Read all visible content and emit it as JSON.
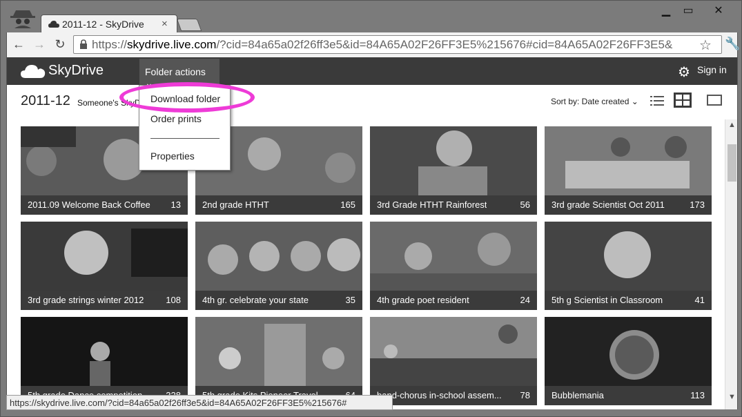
{
  "browser": {
    "tab_title": "2011-12 - SkyDrive",
    "tab_close": "×",
    "url_scheme": "https://",
    "url_host": "skydrive.live.com",
    "url_rest": "/?cid=84a65a02f26ff3e5&id=84A65A02F26FF3E5%215676#cid=84A65A02F26FF3E5&",
    "status_url": "https://skydrive.live.com/?cid=84a65a02f26ff3e5&id=84A65A02F26FF3E5%215676#"
  },
  "header": {
    "brand": "SkyDrive",
    "folder_actions": "Folder actions",
    "sign_in": "Sign in"
  },
  "page": {
    "title": "2011-12",
    "owner_crumb": "Someone's SkyD",
    "sort_label": "Sort by: Date created"
  },
  "dropdown": {
    "items": [
      "Download folder",
      "Order prints",
      "Properties"
    ]
  },
  "folders": [
    {
      "name": "2011.09 Welcome Back Coffee",
      "count": "13"
    },
    {
      "name": "2nd grade HTHT",
      "count": "165"
    },
    {
      "name": "3rd Grade HTHT Rainforest",
      "count": "56"
    },
    {
      "name": "3rd grade Scientist Oct 2011",
      "count": "173"
    },
    {
      "name": "3rd grade strings winter 2012",
      "count": "108"
    },
    {
      "name": "4th gr. celebrate your state",
      "count": "35"
    },
    {
      "name": "4th grade poet resident",
      "count": "24"
    },
    {
      "name": "5th g Scientist in Classroom",
      "count": "41"
    },
    {
      "name": "5th grade Dance competition",
      "count": "328"
    },
    {
      "name": "5th grade Kits Pioneer Travel",
      "count": "64"
    },
    {
      "name": "band-chorus in-school assem...",
      "count": "78"
    },
    {
      "name": "Bubblemania",
      "count": "113"
    }
  ],
  "colors": {
    "highlight": "#ee3bd7",
    "header_bg": "#3a3a3a"
  }
}
